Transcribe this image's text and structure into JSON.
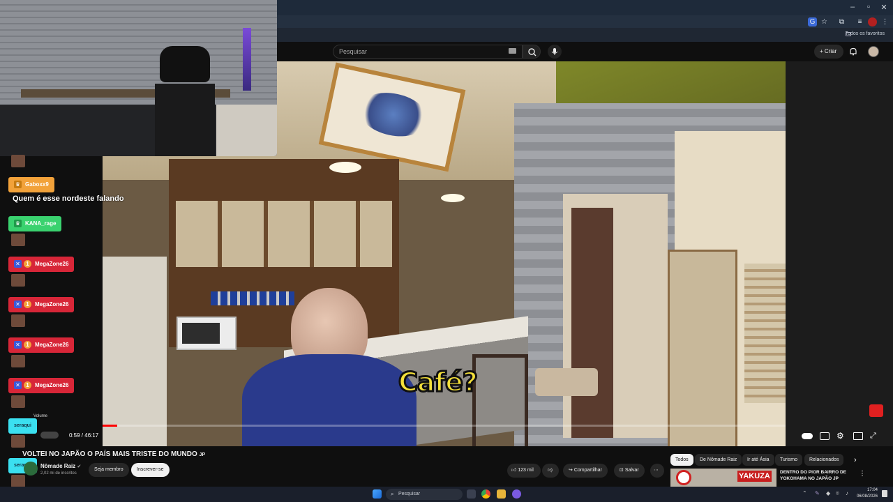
{
  "chrome": {
    "bookmarks_label": "Todos os favoritos"
  },
  "header": {
    "search_placeholder": "Pesquisar",
    "create_label": "Criar"
  },
  "chat": {
    "messages": [
      {
        "user": "Gaboxx9",
        "text": "Quem é esse nordeste falando",
        "color": "#f2a23a"
      },
      {
        "user": "KANA_rage",
        "color": "#3ad26f"
      },
      {
        "user": "MegaZone26",
        "badge": "1",
        "color": "#d72638"
      },
      {
        "user": "MegaZone26",
        "badge": "1",
        "color": "#d72638"
      },
      {
        "user": "MegaZone26",
        "badge": "1",
        "color": "#d72638"
      },
      {
        "user": "MegaZone26",
        "badge": "1",
        "color": "#d72638"
      },
      {
        "user": "seraqui",
        "color": "#3be0f0"
      },
      {
        "user": "seraqui",
        "color": "#3be0f0"
      }
    ]
  },
  "video": {
    "caption": "Café?",
    "time_current": "0:59",
    "time_total": "46:17",
    "time_display": "0:59 / 46:17",
    "volume_tooltip": "Volume",
    "progress_fraction": 0.021,
    "title": "VOLTEI NO JAPÃO O PAÍS MAIS TRISTE DO MUNDO",
    "title_flag": "JP"
  },
  "channel": {
    "name": "Nômade Raiz",
    "subscribers": "2,02 mi de inscritos",
    "member_button": "Seja membro",
    "subscribe_button": "Inscrever-se"
  },
  "actions": {
    "likes": "123 mil",
    "share": "Compartilhar",
    "save": "Salvar"
  },
  "chips": [
    "Todos",
    "De Nômade Raiz",
    "Ir até Ásia",
    "Turismo",
    "Relacionados"
  ],
  "recommended": {
    "thumb_text": "YAKUZA",
    "title": "DENTRO DO PIOR BAIRRO DE YOKOHAMA NO JAPÃO",
    "title_flag": "JP"
  },
  "taskbar": {
    "search_label": "Pesquisar",
    "time": "17:04",
    "date": "06/08/2026"
  },
  "colors": {
    "yt_red": "#ff0000",
    "caption_yellow": "#f4e03a"
  }
}
